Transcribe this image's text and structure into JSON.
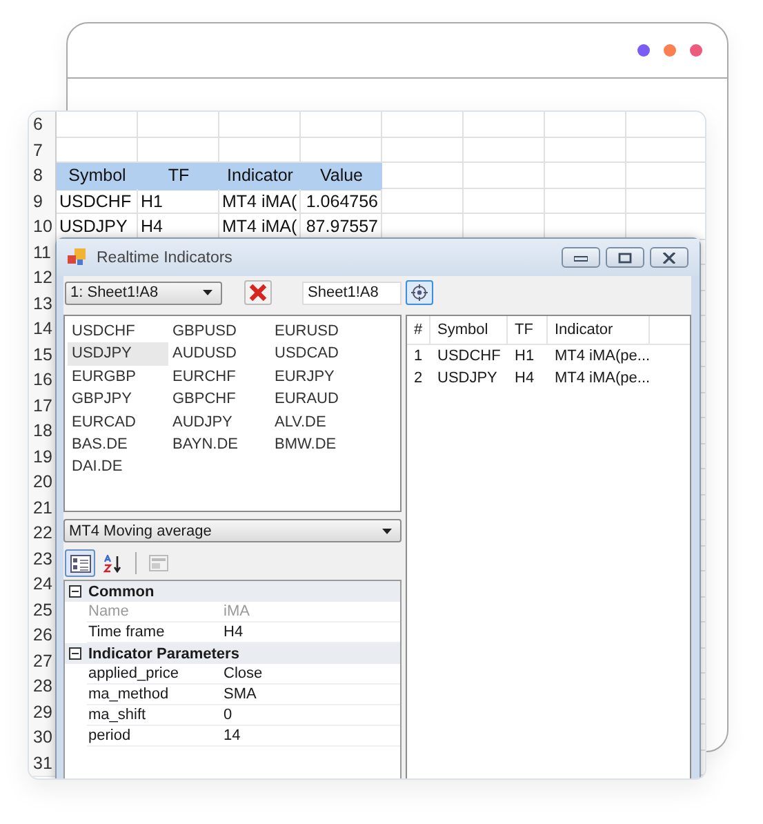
{
  "browser_frame": {
    "dots": [
      {
        "color": "#7b5cf5"
      },
      {
        "color": "#f98150"
      },
      {
        "color": "#ee5b7c"
      }
    ]
  },
  "sheet": {
    "rows": [
      {
        "number": "6",
        "kind": "blank"
      },
      {
        "number": "7",
        "kind": "blank"
      },
      {
        "number": "8",
        "kind": "header",
        "cells": [
          "Symbol",
          "TF",
          "Indicator",
          "Value"
        ]
      },
      {
        "number": "9",
        "kind": "data",
        "cells": [
          "USDCHF",
          "H1",
          "MT4 iMA(",
          "1.064756"
        ]
      },
      {
        "number": "10",
        "kind": "data",
        "cells": [
          "USDJPY",
          "H4",
          "MT4 iMA(",
          "87.97557"
        ]
      },
      {
        "number": "11",
        "kind": "blank"
      },
      {
        "number": "12",
        "kind": "blank"
      },
      {
        "number": "13",
        "kind": "blank"
      },
      {
        "number": "14",
        "kind": "blank"
      },
      {
        "number": "15",
        "kind": "blank"
      },
      {
        "number": "16",
        "kind": "blank"
      },
      {
        "number": "17",
        "kind": "blank"
      },
      {
        "number": "18",
        "kind": "blank"
      },
      {
        "number": "19",
        "kind": "blank"
      },
      {
        "number": "20",
        "kind": "blank"
      },
      {
        "number": "21",
        "kind": "blank"
      },
      {
        "number": "22",
        "kind": "blank"
      },
      {
        "number": "23",
        "kind": "blank"
      },
      {
        "number": "24",
        "kind": "blank"
      },
      {
        "number": "25",
        "kind": "blank"
      },
      {
        "number": "26",
        "kind": "blank"
      },
      {
        "number": "27",
        "kind": "blank"
      },
      {
        "number": "28",
        "kind": "blank"
      },
      {
        "number": "29",
        "kind": "blank"
      },
      {
        "number": "30",
        "kind": "blank"
      },
      {
        "number": "31",
        "kind": "blank"
      }
    ]
  },
  "dialog": {
    "title": "Realtime Indicators",
    "sheet_select": "1: Sheet1!A8",
    "range_field": "Sheet1!A8",
    "symbols": [
      {
        "label": "USDCHF",
        "selected": false
      },
      {
        "label": "GBPUSD",
        "selected": false
      },
      {
        "label": "EURUSD",
        "selected": false
      },
      {
        "label": "USDJPY",
        "selected": true
      },
      {
        "label": "AUDUSD",
        "selected": false
      },
      {
        "label": "USDCAD",
        "selected": false
      },
      {
        "label": "EURGBP",
        "selected": false
      },
      {
        "label": "EURCHF",
        "selected": false
      },
      {
        "label": "EURJPY",
        "selected": false
      },
      {
        "label": "GBPJPY",
        "selected": false
      },
      {
        "label": "GBPCHF",
        "selected": false
      },
      {
        "label": "EURAUD",
        "selected": false
      },
      {
        "label": "EURCAD",
        "selected": false
      },
      {
        "label": "AUDJPY",
        "selected": false
      },
      {
        "label": "ALV.DE",
        "selected": false
      },
      {
        "label": "BAS.DE",
        "selected": false
      },
      {
        "label": "BAYN.DE",
        "selected": false
      },
      {
        "label": "BMW.DE",
        "selected": false
      },
      {
        "label": "DAI.DE",
        "selected": false
      }
    ],
    "indicator_select": "MT4 Moving average",
    "sort_buttons": [
      {
        "kind": "categorized",
        "selected": true
      },
      {
        "kind": "alphabetical",
        "selected": false
      }
    ],
    "pages_button": {
      "disabled": true
    },
    "categories": [
      {
        "name": "Common",
        "expanded": true,
        "properties": [
          {
            "name": "Name",
            "value": "iMA",
            "readonly": true
          },
          {
            "name": "Time frame",
            "value": "H4",
            "readonly": false
          }
        ]
      },
      {
        "name": "Indicator Parameters",
        "expanded": true,
        "properties": [
          {
            "name": "applied_price",
            "value": "Close",
            "readonly": false
          },
          {
            "name": "ma_method",
            "value": "SMA",
            "readonly": false
          },
          {
            "name": "ma_shift",
            "value": "0",
            "readonly": false
          },
          {
            "name": "period",
            "value": "14",
            "readonly": false
          }
        ]
      }
    ],
    "list": {
      "columns": [
        "#",
        "Symbol",
        "TF",
        "Indicator"
      ],
      "rows": [
        [
          "1",
          "USDCHF",
          "H1",
          "MT4 iMA(pe..."
        ],
        [
          "2",
          "USDJPY",
          "H4",
          "MT4 iMA(pe..."
        ]
      ]
    }
  }
}
